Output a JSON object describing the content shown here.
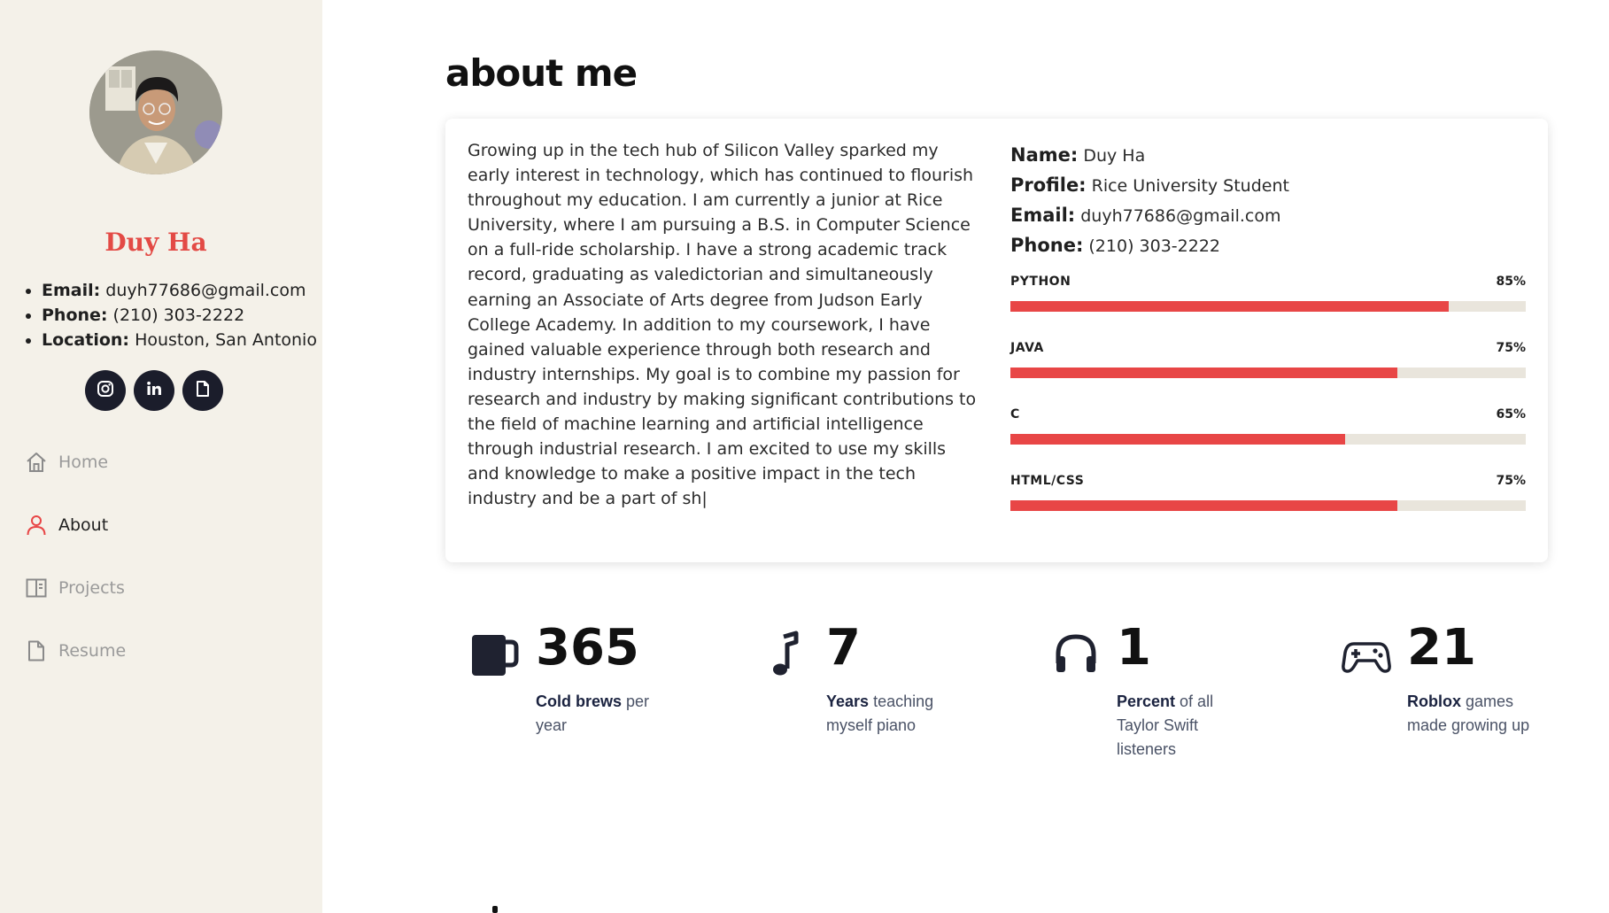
{
  "sidebar": {
    "name": "Duy Ha",
    "contacts": [
      {
        "label": "Email:",
        "value": " duyh77686@gmail.com"
      },
      {
        "label": "Phone:",
        "value": " (210) 303-2222"
      },
      {
        "label": "Location:",
        "value": " Houston, San Antonio"
      }
    ],
    "socials": [
      {
        "icon": "instagram-icon"
      },
      {
        "icon": "linkedin-icon"
      },
      {
        "icon": "document-icon"
      }
    ],
    "nav": [
      {
        "label": "Home",
        "icon": "home-icon",
        "active": false
      },
      {
        "label": "About",
        "icon": "user-icon",
        "active": true
      },
      {
        "label": "Projects",
        "icon": "book-icon",
        "active": false
      },
      {
        "label": "Resume",
        "icon": "file-icon",
        "active": false
      }
    ]
  },
  "main": {
    "title": "about me",
    "bio": "Growing up in the tech hub of Silicon Valley sparked my early interest in technology, which has continued to flourish throughout my education. I am currently a junior at Rice University, where I am pursuing a B.S. in Computer Science on a full-ride scholarship. I have a strong academic track record, graduating as valedictorian and simultaneously earning an Associate of Arts degree from Judson Early College Academy. In addition to my coursework, I have gained valuable experience through both research and industry internships. My goal is to combine my passion for research and industry by making significant contributions to the field of machine learning and artificial intelligence through industrial research. I am excited to use my skills and knowledge to make a positive impact in the tech industry and be a part of sh|",
    "info": [
      {
        "label": "Name:",
        "value": " Duy Ha"
      },
      {
        "label": "Profile:",
        "value": " Rice University Student"
      },
      {
        "label": "Email:",
        "value": " duyh77686@gmail.com"
      },
      {
        "label": "Phone:",
        "value": " (210) 303-2222"
      }
    ],
    "skills": [
      {
        "name": "PYTHON",
        "percent_label": "85%",
        "value": 85
      },
      {
        "name": "JAVA",
        "percent_label": "75%",
        "value": 75
      },
      {
        "name": "C",
        "percent_label": "65%",
        "value": 65
      },
      {
        "name": "HTML/CSS",
        "percent_label": "75%",
        "value": 75
      }
    ],
    "facts": [
      {
        "icon": "mug-icon",
        "number": "365",
        "bold": "Cold brews",
        "rest": " per year"
      },
      {
        "icon": "music-note-icon",
        "number": "7",
        "bold": "Years",
        "rest": " teaching myself piano"
      },
      {
        "icon": "headphones-icon",
        "number": "1",
        "bold": "Percent",
        "rest": " of all Taylor Swift listeners"
      },
      {
        "icon": "gamepad-icon",
        "number": "21",
        "bold": "Roblox",
        "rest": " games made growing up"
      }
    ]
  },
  "colors": {
    "accent": "#e84646",
    "sidebar_bg": "#f4f1e9",
    "track": "#e9e5dc",
    "social_bg": "#1b1d2b"
  }
}
